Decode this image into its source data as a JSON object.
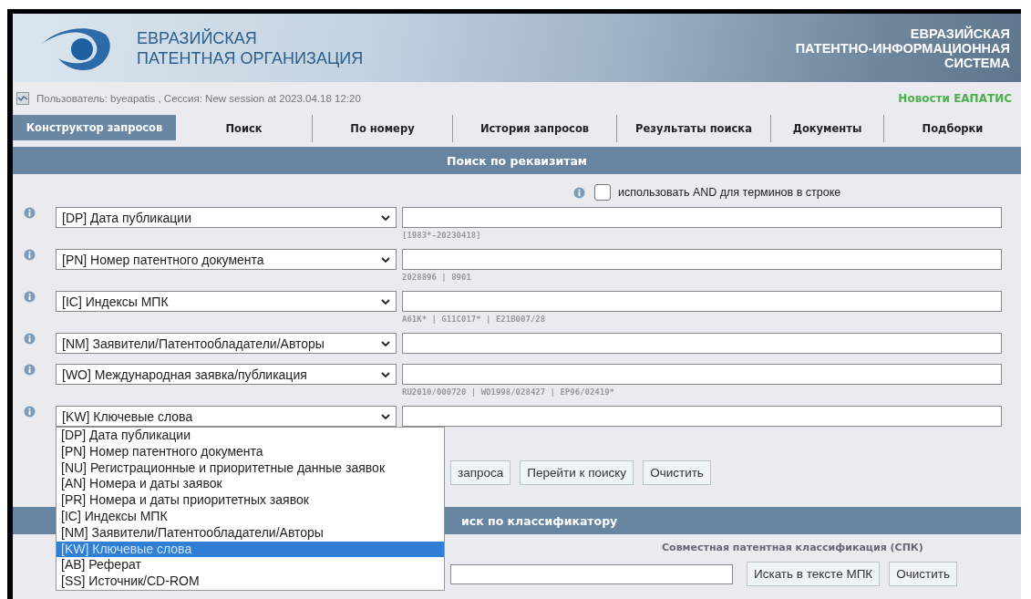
{
  "header": {
    "org_name_lines": [
      "ЕВРАЗИЙСКАЯ",
      "ПАТЕНТНАЯ ОРГАНИЗАЦИЯ"
    ],
    "system_name_lines": [
      "ЕВРАЗИЙСКАЯ",
      "ПАТЕНТНО-ИНФОРМАЦИОННАЯ",
      "СИСТЕМА"
    ]
  },
  "user_bar": {
    "session_text": "Пользователь: byeapatis , Сессия: New session at 2023.04.18 12:20",
    "news_link": "Новости ЕАПАТИС"
  },
  "tabs": [
    {
      "label": "Конструктор запросов",
      "selected": true
    },
    {
      "label": "Поиск",
      "selected": false
    },
    {
      "label": "По номеру",
      "selected": false
    },
    {
      "label": "История запросов",
      "selected": false
    },
    {
      "label": "Результаты поиска",
      "selected": false
    },
    {
      "label": "Документы",
      "selected": false
    },
    {
      "label": "Подборки",
      "selected": false
    }
  ],
  "form": {
    "title": "Поиск по реквизитам",
    "and_option": {
      "label": "использовать AND для терминов в строке",
      "checked": false
    },
    "rows": [
      {
        "field": "[DP] Дата публикации",
        "hint": "[1983*-20230418]",
        "expanded": false
      },
      {
        "field": "[PN] Номер патентного документа",
        "hint": "2028896 | 8901",
        "expanded": false
      },
      {
        "field": "[IC] Индексы МПК",
        "hint": "A61K* | G11C017* | E21B007/28",
        "expanded": false
      },
      {
        "field": "[NM] Заявители/Патентообладатели/Авторы",
        "expanded": false
      },
      {
        "field": "[WO] Международная заявка/публикация",
        "hint": "RU2010/000720 | WO1998/028427 | EP96/02419*",
        "expanded": false
      },
      {
        "field": "[KW] Ключевые слова",
        "expanded": true,
        "options": [
          {
            "label": "[DP] Дата публикации",
            "selected": false
          },
          {
            "label": "[PN] Номер патентного документа",
            "selected": false
          },
          {
            "label": "[NU] Регистрационные и приоритетные данные заявок",
            "selected": false
          },
          {
            "label": "[AN] Номера и даты заявок",
            "selected": false
          },
          {
            "label": "[PR] Номера и даты приоритетных заявок",
            "selected": false
          },
          {
            "label": "[IC] Индексы МПК",
            "selected": false
          },
          {
            "label": "[NM] Заявители/Патентообладатели/Авторы",
            "selected": false
          },
          {
            "label": "[KW] Ключевые слова",
            "selected": true
          },
          {
            "label": "[AB] Реферат",
            "selected": false
          },
          {
            "label": "[SS] Источник/CD-ROM",
            "selected": false
          }
        ]
      }
    ],
    "buttons": [
      "запроса",
      "Перейти к поиску",
      "Очистить"
    ]
  },
  "classifier": {
    "title": "иск по классификатору",
    "scheme": "Совместная патентная классификация (СПК)",
    "buttons": [
      "Искать в тексте МПК",
      "Очистить"
    ]
  }
}
